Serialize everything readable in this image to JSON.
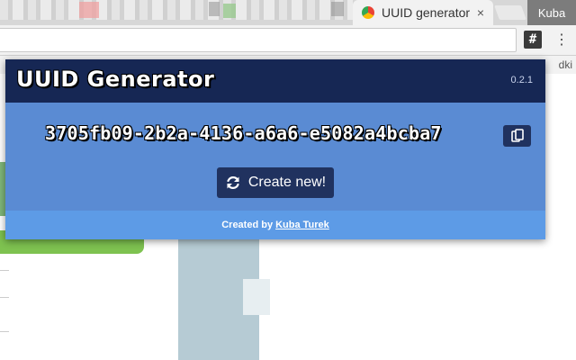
{
  "browser": {
    "tab_title": "UUID generator",
    "tab_close": "×",
    "profile_name": "Kuba",
    "extension_icon": "#",
    "menu_icon": "⋮",
    "bookmarks_overflow": "dki"
  },
  "popup": {
    "title": "UUID Generator",
    "version": "0.2.1",
    "uuid": "3705fb09-2b2a-4136-a6a6-e5082a4bcba7",
    "create_button_label": "Create new!",
    "footer_prefix": "Created by",
    "footer_author": "Kuba Turek",
    "icons": {
      "copy": "copy-icon",
      "refresh": "refresh-icon"
    },
    "colors": {
      "header": "#162754",
      "body": "#5a8bd3",
      "footer": "#5d9be6",
      "button": "#20325f"
    }
  }
}
